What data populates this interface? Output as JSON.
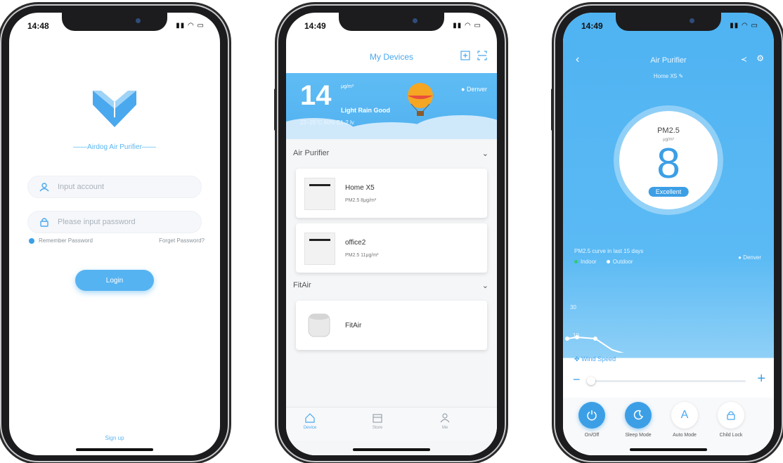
{
  "login": {
    "time": "14:48",
    "brand": "——Airdog Air Purifier——",
    "account_placeholder": "Input account",
    "password_placeholder": "Please input password",
    "remember": "Remember Password",
    "forgot": "Forget Password?",
    "login_button": "Login",
    "signup": "Sign up"
  },
  "devices": {
    "time": "14:49",
    "title": "My Devices",
    "weather": {
      "pm": "14",
      "unit": "μg/m³",
      "desc": "Light Rain Good",
      "line": "23~25°C  60%  E1-2 lv",
      "city": "Denver"
    },
    "sections": [
      {
        "name": "Air Purifier"
      },
      {
        "name": "FitAir"
      }
    ],
    "cards": [
      {
        "name": "Home X5",
        "pm": "PM2.5 8μg/m³"
      },
      {
        "name": "office2",
        "pm": "PM2.5 11μg/m³"
      },
      {
        "name": "FitAir",
        "pm": ""
      }
    ],
    "tabs": [
      "Device",
      "Store",
      "Me"
    ]
  },
  "purifier": {
    "time": "14:49",
    "title": "Air Purifier",
    "subtitle": "Home X5",
    "pm_label": "PM2.5",
    "pm_unit": "μg/m³",
    "pm_value": "8",
    "quality": "Excellent",
    "curve_text": "PM2.5 curve in last 15 days",
    "legend_indoor": "Indoor",
    "legend_outdoor": "Outdoor",
    "city": "Denver",
    "chart_label_30": "30",
    "chart_label_10": "10",
    "wind": "Wind Speed",
    "controls": [
      "On/Off",
      "Sleep Mode",
      "Auto Mode",
      "Child Lock"
    ],
    "auto_letter": "A"
  },
  "colors": {
    "accent": "#3c9fe6",
    "sky": "#52b2f0"
  }
}
